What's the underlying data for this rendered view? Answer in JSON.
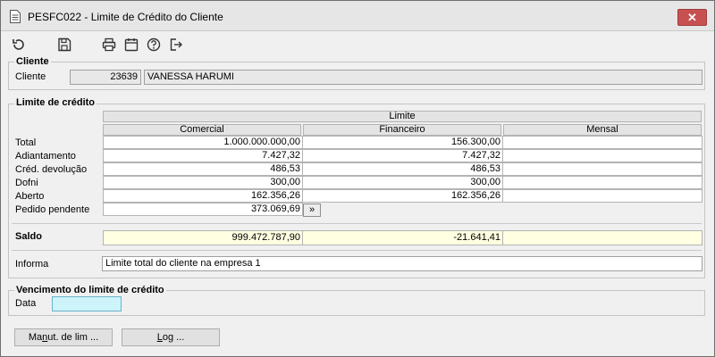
{
  "window": {
    "title": "PESFC022 - Limite de Crédito do Cliente",
    "close_label": "✕"
  },
  "toolbar": {
    "buttons": [
      {
        "name": "refresh-icon"
      },
      {
        "name": "save-icon"
      },
      {
        "name": "print-icon"
      },
      {
        "name": "calendar-icon"
      },
      {
        "name": "help-icon"
      },
      {
        "name": "exit-icon"
      }
    ]
  },
  "cliente": {
    "group_title": "Cliente",
    "label": "Cliente",
    "code": "23639",
    "name": "VANESSA HARUMI"
  },
  "limite": {
    "group_title": "Limite de  crédito",
    "header_limite": "Limite",
    "columns": [
      "Comercial",
      "Financeiro",
      "Mensal"
    ],
    "rows": [
      {
        "label": "Total",
        "values": [
          "1.000.000.000,00",
          "156.300,00",
          ""
        ]
      },
      {
        "label": "Adiantamento",
        "values": [
          "7.427,32",
          "7.427,32",
          ""
        ]
      },
      {
        "label": "Créd. devolução",
        "values": [
          "486,53",
          "486,53",
          ""
        ]
      },
      {
        "label": "Dofni",
        "values": [
          "300,00",
          "300,00",
          ""
        ]
      },
      {
        "label": "Aberto",
        "values": [
          "162.356,26",
          "162.356,26",
          ""
        ]
      }
    ],
    "pedido_label": "Pedido pendente",
    "pedido_value": "373.069,69",
    "pedido_btn": "»",
    "saldo_label": "Saldo",
    "saldo_values": [
      "999.472.787,90",
      "-21.641,41",
      ""
    ],
    "informa_label": "Informa",
    "informa_value": "Limite total do cliente na empresa 1"
  },
  "vencimento": {
    "group_title": "Vencimento do limite de crédito",
    "data_label": "Data",
    "data_value": ""
  },
  "buttons": {
    "manut_pre": "Ma",
    "manut_ul": "n",
    "manut_post": "ut. de lim ...",
    "log_pre": "",
    "log_ul": "L",
    "log_post": "og ..."
  }
}
